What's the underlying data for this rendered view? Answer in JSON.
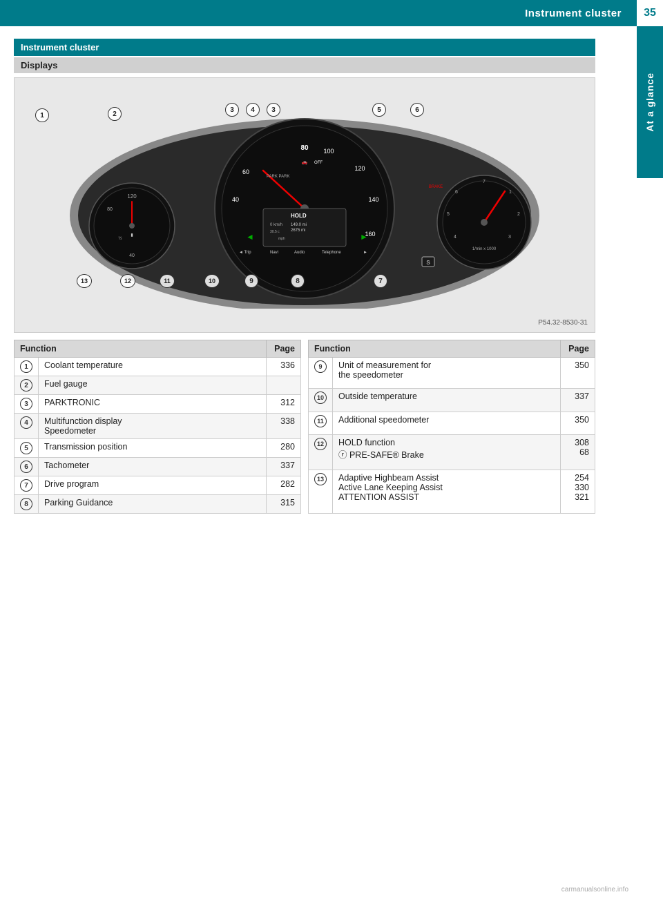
{
  "header": {
    "title": "Instrument cluster",
    "page_number": "35"
  },
  "side_tab": {
    "label": "At a glance"
  },
  "section": {
    "title": "Instrument cluster",
    "subsection": "Displays"
  },
  "diagram": {
    "reference": "P54.32-8530-31"
  },
  "left_table": {
    "col_function": "Function",
    "col_page": "Page",
    "rows": [
      {
        "num": "1",
        "function": "Coolant temperature",
        "page": "336"
      },
      {
        "num": "2",
        "function": "Fuel gauge",
        "page": ""
      },
      {
        "num": "3",
        "function": "PARKTRONIC",
        "page": "312"
      },
      {
        "num": "4",
        "function": "Multifunction display\nSpeedometer",
        "page": "338"
      },
      {
        "num": "5",
        "function": "Transmission position",
        "page": "280"
      },
      {
        "num": "6",
        "function": "Tachometer",
        "page": "337"
      },
      {
        "num": "7",
        "function": "Drive program",
        "page": "282"
      },
      {
        "num": "8",
        "function": "Parking Guidance",
        "page": "315"
      }
    ]
  },
  "right_table": {
    "col_function": "Function",
    "col_page": "Page",
    "rows": [
      {
        "num": "9",
        "function": "Unit of measurement for\nthe speedometer",
        "page": "350"
      },
      {
        "num": "10",
        "function": "Outside temperature",
        "page": "337"
      },
      {
        "num": "11",
        "function": "Additional speedometer",
        "page": "350"
      },
      {
        "num": "12",
        "function": "HOLD function\nⓡ PRE-SAFE® Brake",
        "page": "308\n68"
      },
      {
        "num": "13",
        "function": "Adaptive Highbeam Assist\nActive Lane Keeping Assist\nATTENTION ASSIST",
        "page": "254\n330\n321"
      }
    ]
  },
  "watermark": "carmanualsonline.info"
}
